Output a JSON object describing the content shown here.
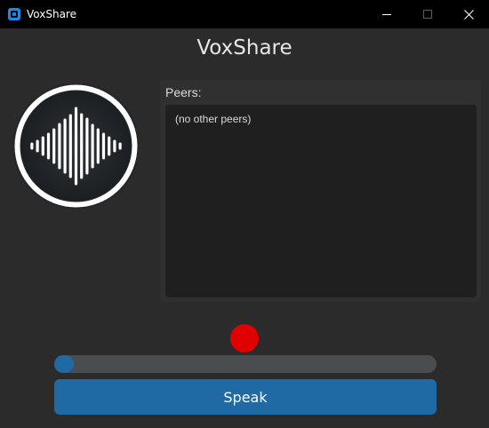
{
  "window": {
    "title": "VoxShare",
    "minimize_label": "─",
    "maximize_label": "☐",
    "close_label": "✕"
  },
  "app": {
    "title": "VoxShare",
    "logo_icon": "sound-wave-icon"
  },
  "peers": {
    "label": "Peers:",
    "items": [],
    "empty_text": "(no other peers)"
  },
  "recording": {
    "indicator_color": "#e00000",
    "level_fraction": 0.05
  },
  "speak_button": {
    "label": "Speak"
  },
  "colors": {
    "accent": "#1f6aa5",
    "background": "#2b2b2b",
    "panel": "#303030",
    "list_background": "#1f1f1f",
    "track": "#4a4d50"
  }
}
